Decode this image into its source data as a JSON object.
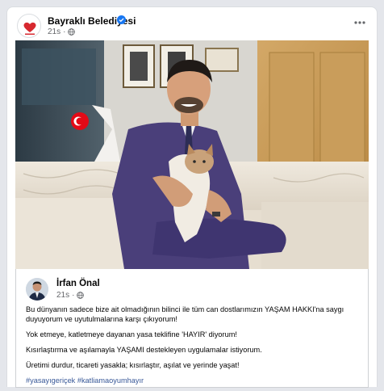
{
  "post": {
    "page_name": "Bayraklı Belediyesi",
    "time": "21s",
    "verified_color": "#1877f2",
    "icons": {
      "verified": "verified-badge-icon",
      "privacy": "globe-icon",
      "more": "more-options-icon"
    }
  },
  "shared_post": {
    "author": "İrfan Önal",
    "time": "21s",
    "paragraphs": [
      "Bu dünyanın sadece bize ait olmadığının bilinci ile tüm can dostlarımızın YAŞAM HAKKI'na saygı duyuyorum ve uyutulmalarına karşı çıkıyorum!",
      "Yok etmeye, katletmeye dayanan yasa teklifine 'HAYIR' diyorum!",
      "Kısırlaştırma ve aşılamayla YAŞAMI destekleyen uygulamalar istiyorum.",
      "Üretimi durdur, ticareti yasakla; kısırlaştır, aşılat ve yerinde yaşat!"
    ],
    "hashtags": [
      "#yasayıgeriçek",
      "#katliamaoyumhayır"
    ]
  }
}
